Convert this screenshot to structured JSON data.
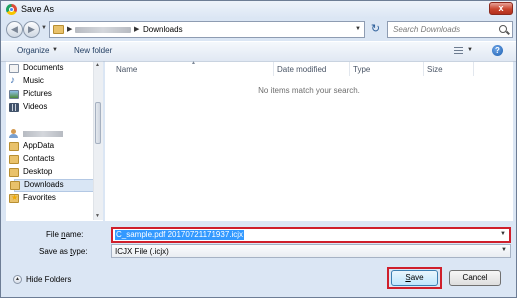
{
  "window": {
    "title": "Save As",
    "close_glyph": "x"
  },
  "nav": {
    "back_glyph": "◀",
    "forward_glyph": "▶",
    "breadcrumb_separator": "▶",
    "current_folder": "Downloads",
    "refresh_glyph": "↻"
  },
  "search": {
    "placeholder": "Search Downloads"
  },
  "toolbar": {
    "organize_label": "Organize",
    "new_folder_label": "New folder",
    "help_glyph": "?"
  },
  "sidebar": {
    "libraries": [
      {
        "label": "Documents",
        "icon": "documents-icon"
      },
      {
        "label": "Music",
        "icon": "music-icon"
      },
      {
        "label": "Pictures",
        "icon": "pictures-icon"
      },
      {
        "label": "Videos",
        "icon": "videos-icon"
      }
    ],
    "user_folders": [
      {
        "label": "AppData",
        "icon": "folder-icon"
      },
      {
        "label": "Contacts",
        "icon": "folder-icon"
      },
      {
        "label": "Desktop",
        "icon": "folder-icon"
      },
      {
        "label": "Downloads",
        "icon": "folder-icon",
        "selected": true
      },
      {
        "label": "Favorites",
        "icon": "favorites-icon"
      }
    ]
  },
  "file_list": {
    "columns": [
      "Name",
      "Date modified",
      "Type",
      "Size"
    ],
    "empty_message": "No items match your search."
  },
  "form": {
    "file_name_label_prefix": "File ",
    "file_name_label_key": "n",
    "file_name_label_suffix": "ame:",
    "file_name_value": "C_sample.pdf 20170721171937.icjx",
    "save_type_label_prefix": "Save as ",
    "save_type_label_key": "t",
    "save_type_label_suffix": "ype:",
    "save_type_value": "ICJX File (.icjx)"
  },
  "footer": {
    "hide_folders_label": "Hide Folders",
    "save_key": "S",
    "save_rest": "ave",
    "cancel_label": "Cancel"
  },
  "colors": {
    "highlight_outline": "#cf1f2b",
    "selection": "#3399ff"
  }
}
